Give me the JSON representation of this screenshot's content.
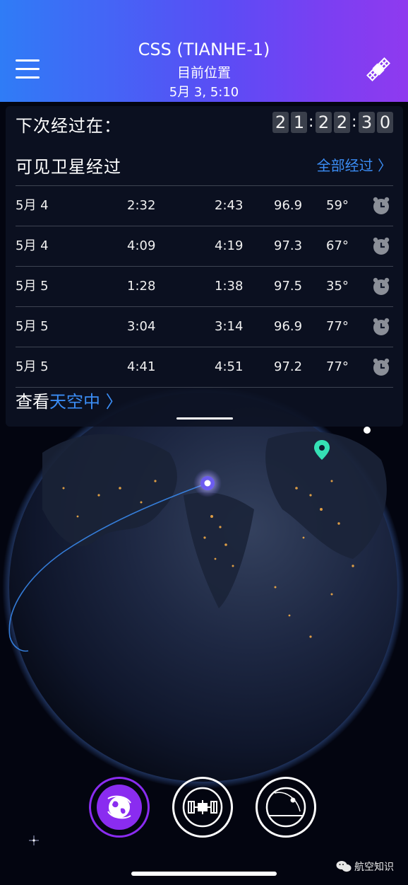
{
  "header": {
    "title": "CSS (TIANHE-1)",
    "subtitle": "目前位置",
    "timestamp": "5月 3, 5:10"
  },
  "panel": {
    "next_pass_label": "下次经过在：",
    "countdown": [
      "2",
      "1",
      ":",
      "2",
      "2",
      ":",
      "3",
      "0"
    ],
    "visible_passes_label": "可见卫星经过",
    "all_passes_link": "全部经过 〉",
    "passes": [
      {
        "date": "5月 4",
        "rise": "2:32",
        "set": "2:43",
        "mag": "96.9",
        "elev": "59°"
      },
      {
        "date": "5月 4",
        "rise": "4:09",
        "set": "4:19",
        "mag": "97.3",
        "elev": "67°"
      },
      {
        "date": "5月 5",
        "rise": "1:28",
        "set": "1:38",
        "mag": "97.5",
        "elev": "35°"
      },
      {
        "date": "5月 5",
        "rise": "3:04",
        "set": "3:14",
        "mag": "96.9",
        "elev": "77°"
      },
      {
        "date": "5月 5",
        "rise": "4:41",
        "set": "4:51",
        "mag": "97.2",
        "elev": "77°"
      }
    ],
    "view_label": "查看",
    "view_link": "天空中 〉"
  },
  "nav": {
    "globe": "globe-icon",
    "iss": "iss-icon",
    "sky": "sky-view-icon"
  },
  "watermark": "航空知识",
  "colors": {
    "accent_blue": "#3b8df5",
    "accent_purple": "#8a2cf0",
    "header_start": "#2f7cf6",
    "header_end": "#8f3aef"
  }
}
